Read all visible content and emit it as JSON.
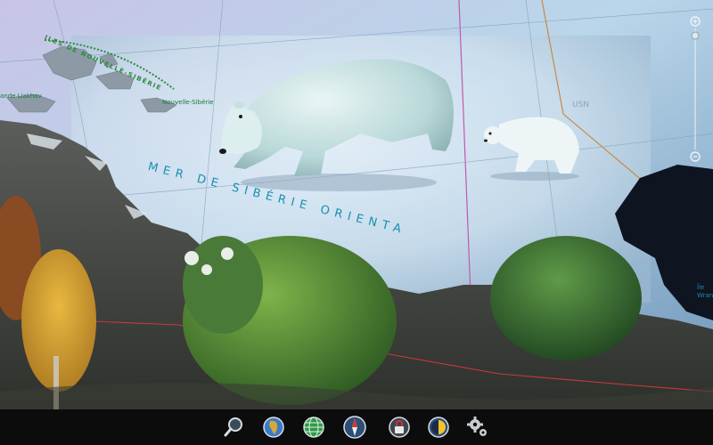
{
  "map": {
    "sea_label": "MER DE SIBÉRIE ORIENTA",
    "islands_label": "ILES DE NOUVELLE-SIBÉRIE",
    "nsib_label": "Nouvelle-Sibérie",
    "liakhov_label": "ande Liakhov",
    "wrangel_label_1": "Île",
    "wrangel_label_2": "Wran",
    "colors": {
      "sea_label": "#1a8fb0",
      "island_label": "#147a35"
    }
  },
  "toolbar": {
    "buttons": [
      {
        "icon": "magnifier-icon",
        "label": "search"
      },
      {
        "icon": "africa-globe-icon",
        "label": "globe"
      },
      {
        "icon": "grid-globe-icon",
        "label": "grid"
      },
      {
        "icon": "compass-icon",
        "label": "compass"
      },
      {
        "icon": "lock-icon",
        "label": "lock"
      },
      {
        "icon": "day-night-icon",
        "label": "day-night"
      },
      {
        "icon": "settings-icon",
        "label": "settings"
      }
    ]
  },
  "zoom": {
    "in_icon": "zoom-in-icon",
    "out_icon": "zoom-out-icon"
  }
}
